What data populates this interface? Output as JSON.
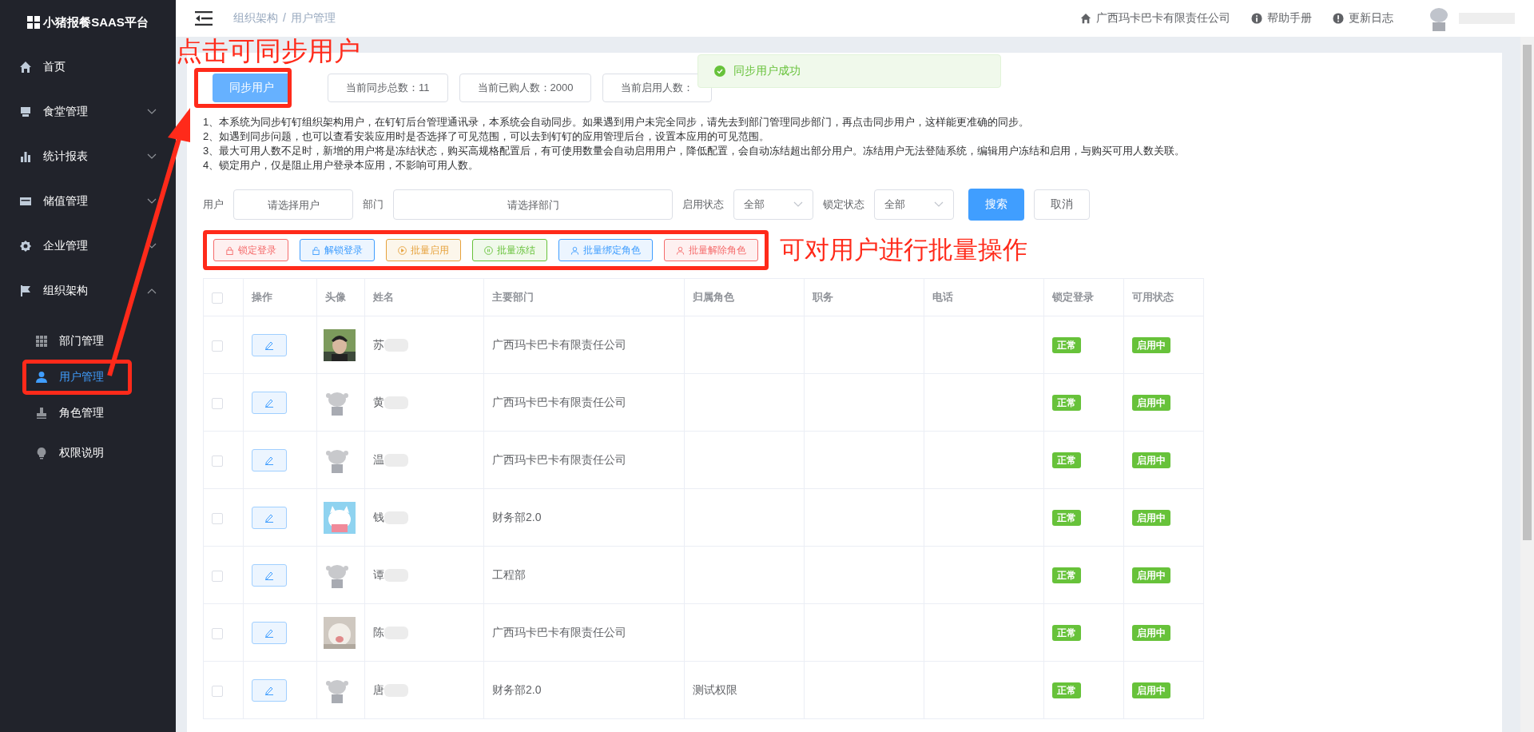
{
  "app_title": "小猪报餐SAAS平台",
  "sidebar": {
    "items": [
      {
        "label": "首页",
        "selected": false
      },
      {
        "label": "食堂管理",
        "expanded": false,
        "selected": false
      },
      {
        "label": "统计报表",
        "expanded": false,
        "selected": false
      },
      {
        "label": "储值管理",
        "expanded": false,
        "selected": false
      },
      {
        "label": "企业管理",
        "expanded": false,
        "selected": false
      },
      {
        "label": "组织架构",
        "expanded": true,
        "selected": false,
        "children": [
          {
            "label": "部门管理",
            "selected": false
          },
          {
            "label": "用户管理",
            "selected": true
          },
          {
            "label": "角色管理",
            "selected": false
          },
          {
            "label": "权限说明",
            "selected": false
          }
        ]
      }
    ]
  },
  "header": {
    "breadcrumb": [
      "组织架构",
      "用户管理"
    ],
    "breadcrumb_separator": "/",
    "links": [
      "广西玛卡巴卡有限责任公司",
      "帮助手册",
      "更新日志"
    ]
  },
  "sync_button": "同步用户",
  "stats": [
    "当前同步总数：11",
    "当前已购人数：2000",
    "当前启用人数："
  ],
  "toast": "同步用户成功",
  "notes": [
    "1、本系统为同步钉钉组织架构用户，在钉钉后台管理通讯录，本系统会自动同步。如果遇到用户未完全同步，请先去到部门管理同步部门，再点击同步用户，这样能更准确的同步。",
    "2、如遇到同步问题，也可以查看安装应用时是否选择了可见范围，可以去到钉钉的应用管理后台，设置本应用的可见范围。",
    "3、最大可用人数不足时，新增的用户将是冻结状态，购买高规格配置后，有可使用数量会自动启用用户，降低配置，会自动冻结超出部分用户。冻结用户无法登陆系统，编辑用户冻结和启用，与购买可用人数关联。",
    "4、锁定用户，仅是阻止用户登录本应用，不影响可用人数。"
  ],
  "filters": [
    {
      "label": "用户",
      "placeholder": "请选择用户",
      "kind": "input"
    },
    {
      "label": "部门",
      "placeholder": "请选择部门",
      "kind": "wide"
    },
    {
      "label": "启用状态",
      "value": "全部",
      "kind": "select"
    },
    {
      "label": "锁定状态",
      "value": "全部",
      "kind": "select"
    }
  ],
  "search_button": "搜索",
  "cancel_button": "取消",
  "batch_buttons": [
    {
      "label": "锁定登录",
      "color": "#f56c6c"
    },
    {
      "label": "解锁登录",
      "color": "#409eff"
    },
    {
      "label": "批量启用",
      "color": "#e6a23c"
    },
    {
      "label": "批量冻结",
      "color": "#67c23a"
    },
    {
      "label": "批量绑定角色",
      "color": "#409eff"
    },
    {
      "label": "批量解除角色",
      "color": "#f56c6c"
    }
  ],
  "table": {
    "select_all_checked": false,
    "columns": [
      "操作",
      "头像",
      "姓名",
      "主要部门",
      "归属角色",
      "职务",
      "电话",
      "锁定登录",
      "可用状态"
    ],
    "rows": [
      {
        "checked": false,
        "name": "苏",
        "department": "广西玛卡巴卡有限责任公司",
        "lock": "正常",
        "status": "启用中"
      },
      {
        "checked": false,
        "kind": "default",
        "name": "黄",
        "department": "广西玛卡巴卡有限责任公司",
        "lock": "正常",
        "status": "启用中"
      },
      {
        "checked": false,
        "kind": "default",
        "name": "温",
        "department": "广西玛卡巴卡有限责任公司",
        "lock": "正常",
        "status": "启用中"
      },
      {
        "checked": false,
        "kind": "cartoon",
        "name": "钱",
        "department": "财务部2.0",
        "lock": "正常",
        "status": "启用中"
      },
      {
        "checked": false,
        "kind": "default",
        "name": "谭",
        "department": "工程部",
        "lock": "正常",
        "status": "启用中"
      },
      {
        "checked": false,
        "kind": "photo2",
        "name": "陈",
        "department": "广西玛卡巴卡有限责任公司",
        "lock": "正常",
        "status": "启用中"
      },
      {
        "checked": false,
        "kind": "default",
        "name": "唐",
        "department": "财务部2.0",
        "role": "测试权限",
        "lock": "正常",
        "status": "启用中"
      }
    ]
  },
  "annotations": [
    "点击可同步用户",
    "可对用户进行批量操作"
  ]
}
